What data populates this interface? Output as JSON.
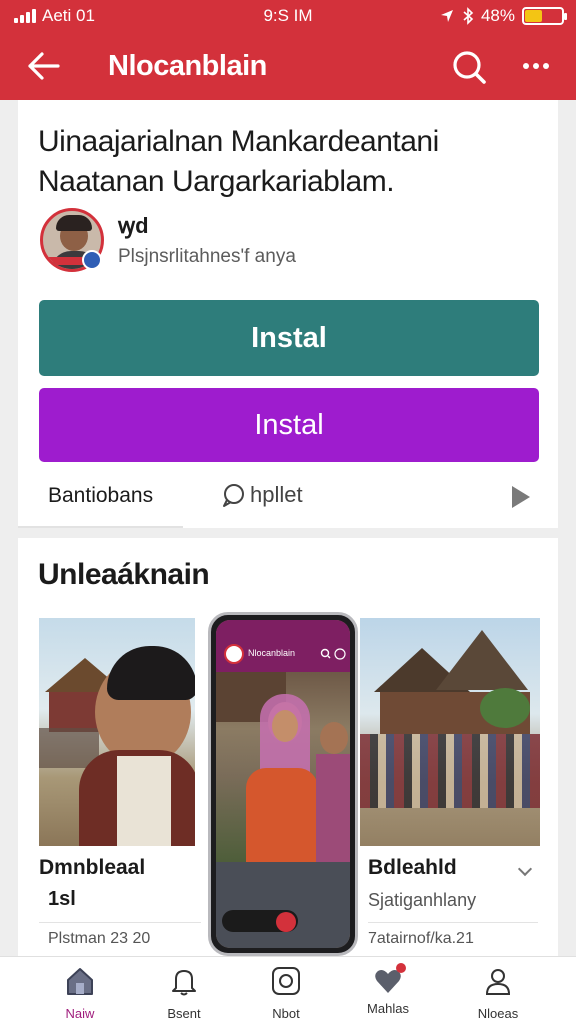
{
  "status_bar": {
    "carrier": "Aeti 01",
    "time": "9:S IM",
    "battery": "48%",
    "battery_level": 0.48
  },
  "app_bar": {
    "title": "Nlocanblain",
    "icons": [
      "back-arrow-icon",
      "search-icon",
      "more-icon"
    ]
  },
  "article": {
    "headline": "Uinaajarialnan Mankardeantani Naatanan Uargarkariablam.",
    "author": "ꝡd",
    "meta": "Plsjnsrlitahnes'f anya",
    "install_primary": "Instal",
    "install_secondary": "Instal",
    "tab_left": "Bantiobans",
    "tab_right": "hpllet"
  },
  "section": {
    "title": "Unleaáknain",
    "left_card": {
      "caption": "Dmnbleaal",
      "subtitle": "1sl",
      "date": "Plstman 23 20"
    },
    "right_card": {
      "caption": "Bdleahld",
      "subtitle": "Sjatiganhlany",
      "date": "7atairnof/ka.21"
    },
    "phone": {
      "title": "Nlocanblain"
    }
  },
  "bottom_nav": [
    {
      "label": "Naiw",
      "icon": "home-icon",
      "active": true
    },
    {
      "label": "Bsent",
      "icon": "bell-icon",
      "active": false
    },
    {
      "label": "Nbot",
      "icon": "camera-icon",
      "active": false
    },
    {
      "label": "Mahlas",
      "icon": "heart-icon",
      "active": false
    },
    {
      "label": "Nloeas",
      "icon": "profile-icon",
      "active": false
    }
  ],
  "colors": {
    "brand_red": "#d3313b",
    "teal": "#2e7d7b",
    "purple": "#9e1cce"
  }
}
